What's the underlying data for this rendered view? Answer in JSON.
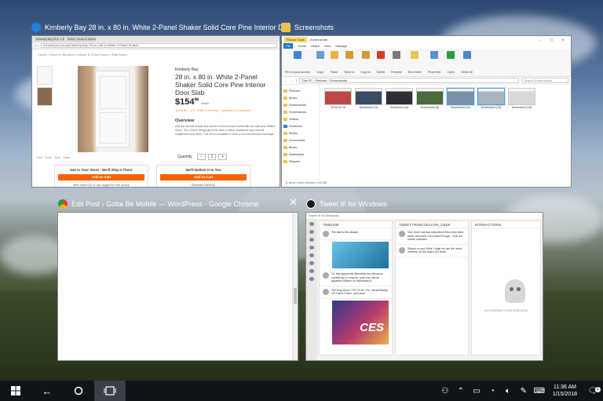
{
  "windows": {
    "edge": {
      "title": "Kimberly Bay 28 in. x 80 in. White 2-Panel Shaker Solid Core Pine Interior Door Slab-DPSHA...",
      "url": "homedepot.com/p/Kimberly-Bay-28-in-x-80-in-White-2-Panel-Shaker...",
      "breadcrumb": "Home / Doors & Windows / Interior & Closet Doors / Slab Doors",
      "brand": "Kimberly Bay",
      "product_title": "28 in. x 80 in. White 2-Panel Shaker Solid Core Pine Interior Door Slab",
      "price": "$154",
      "price_cents": "98",
      "price_unit": "/each",
      "rating": "★★★★☆ 4.6 · Write a Review · Questions & Answers",
      "overview_heading": "Overview",
      "overview_text": "Add the colonial beauty and warmth of wood to your home with our solid pine Shaker doors. The 2-Panel design gives this door a classic, traditional style that will complement any decor. This door is available in sizes to fit most standard doorways.",
      "quantity_label": "Quantity",
      "quantity_value": "1",
      "share_row": "Print  ·  Email  ·  Save  ·  Share",
      "box_left_heading": "Not in Your Store - We'll Ship It There",
      "box_left_button": "Add to Cart",
      "box_left_footer": "We'll send it to S Las Vegas for free pickup",
      "box_right_heading": "We'll Deliver It to You",
      "box_right_button": "Add to Cart",
      "box_right_footer": "Standard Delivery"
    },
    "explorer": {
      "title": "Screenshots",
      "context_tab": "Picture Tools",
      "context_title": "Screenshots",
      "menus": [
        "File",
        "Home",
        "Share",
        "View",
        "Manage"
      ],
      "ribbon_groups": [
        {
          "label": "Pin to Quick access",
          "color": "#3f85d8"
        },
        {
          "label": "Copy",
          "color": "#6b9bd2"
        },
        {
          "label": "Paste",
          "color": "#e5b54a"
        },
        {
          "label": "Move to",
          "color": "#d59a3a"
        },
        {
          "label": "Copy to",
          "color": "#d59a3a"
        },
        {
          "label": "Delete",
          "color": "#d23c2b"
        },
        {
          "label": "Rename",
          "color": "#7a7a7a"
        },
        {
          "label": "New folder",
          "color": "#e8c54d"
        },
        {
          "label": "Properties",
          "color": "#5c8fd1"
        },
        {
          "label": "Open",
          "color": "#2d9b46"
        },
        {
          "label": "Select all",
          "color": "#4d86c9"
        }
      ],
      "path": "This PC › Pictures › Screenshots",
      "search_placeholder": "Search Screenshots",
      "nav": [
        {
          "label": "Pictures",
          "type": "folder"
        },
        {
          "label": "Music",
          "type": "folder"
        },
        {
          "label": "Screenshots",
          "type": "folder"
        },
        {
          "label": "Screenshots",
          "type": "folder"
        },
        {
          "label": "Videos",
          "type": "folder"
        },
        {
          "label": "OneDrive",
          "type": "cloud"
        },
        {
          "label": "Books",
          "type": "folder"
        },
        {
          "label": "Documents",
          "type": "folder"
        },
        {
          "label": "Music",
          "type": "folder"
        },
        {
          "label": "Notebooks",
          "type": "folder"
        },
        {
          "label": "Pictures",
          "type": "folder"
        }
      ],
      "files": [
        {
          "label": "2018-01-15",
          "color": "#b84a43",
          "selected": false
        },
        {
          "label": "Screenshot (5)",
          "color": "#3a4a63",
          "selected": false
        },
        {
          "label": "Screenshot (6)",
          "color": "#2c2f36",
          "selected": false
        },
        {
          "label": "Screenshot (8)",
          "color": "#4a6b3e",
          "selected": false
        },
        {
          "label": "Screenshot (11)",
          "color": "#7b8fa6",
          "selected": true
        },
        {
          "label": "Screenshot (12)",
          "color": "#a8b3bf",
          "selected": true
        },
        {
          "label": "Screenshot (13)",
          "color": "#d9d9d9",
          "selected": false
        }
      ],
      "status": "11 items    1 item selected    3.99 MB"
    },
    "chrome": {
      "title": "Edit Post ‹ Gotta Be Mobile — WordPress - Google Chrome"
    },
    "tweetit": {
      "title": "Tweet It! for Windows",
      "app_titlebar": "Tweet It! for Windows",
      "col1_header": "TIMELINE",
      "col2_header": "TWEET FROM DEACON_GEEK",
      "col3_header": "INTERACTIONS",
      "tweets": [
        "The dad is this always!",
        "TIL that apparently @winclick and @maxrm something, in common, each has had an apparent children on #Windows10.",
        "Ted Tong-Dixon: CES 2018: TVs, Virtual Reality, VR Future Driven, and more!"
      ],
      "media_caption": "CES",
      "detail_text": "Man, there had two episodes of this every hand week, and cans, I've looked through, I took the screen episodes.",
      "reply_text": "Shame on you! Write 'I shall not use the mirror universe' on the board 100 times",
      "no_interactions": "NO INTERACTIONS FOR NOW"
    }
  },
  "taskbar": {
    "time": "11:36 AM",
    "date": "1/15/2018",
    "notification_count": "1"
  }
}
